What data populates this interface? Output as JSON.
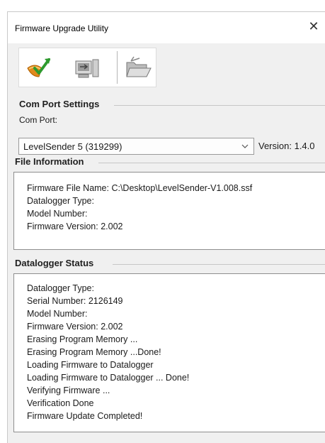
{
  "window": {
    "title": "Firmware Upgrade Utility",
    "close_glyph": "✕"
  },
  "toolbar": {
    "buttons": [
      {
        "name": "upgrade-icon"
      },
      {
        "name": "computer-transfer-icon"
      },
      {
        "name": "folder-open-icon"
      }
    ]
  },
  "com_port": {
    "section_title": "Com Port Settings",
    "label": "Com Port:",
    "selected_value": "LevelSender 5 (319299)",
    "version_text": "Version: 1.4.0"
  },
  "file_info": {
    "section_title": "File Information",
    "lines": [
      "Firmware File Name: C:\\Desktop\\LevelSender-V1.008.ssf",
      "Datalogger Type:",
      "Model Number:",
      "Firmware Version: 2.002"
    ]
  },
  "status": {
    "section_title": "Datalogger Status",
    "lines": [
      "Datalogger Type:",
      "Serial Number: 2126149",
      "Model Number:",
      "Firmware Version: 2.002",
      "Erasing Program Memory ...",
      "Erasing Program Memory ...Done!",
      "Loading Firmware to Datalogger",
      "Loading Firmware to Datalogger ... Done!",
      "Verifying Firmware ...",
      "Verification Done",
      "Firmware Update Completed!"
    ]
  }
}
